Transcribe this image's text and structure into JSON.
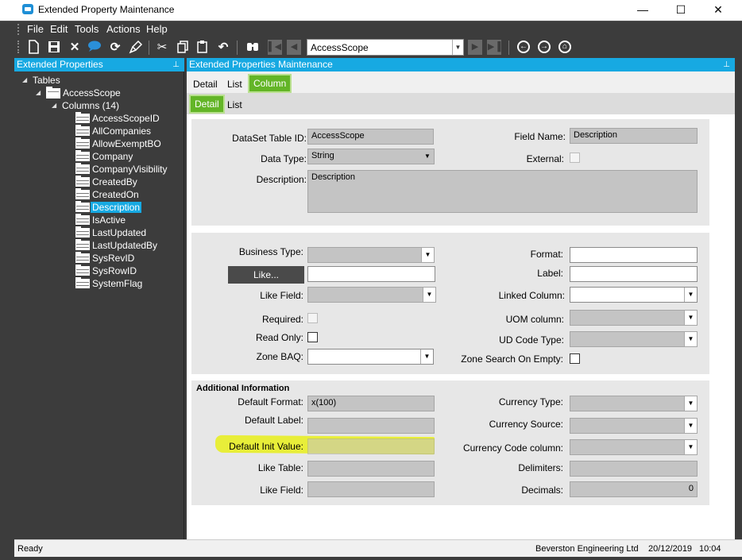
{
  "window": {
    "title": "Extended Property Maintenance",
    "minimize": "—",
    "maximize": "☐",
    "close": "✕"
  },
  "menu": [
    "File",
    "Edit",
    "Tools",
    "Actions",
    "Help"
  ],
  "toolbar": {
    "combo_value": "AccessScope"
  },
  "left_panel": {
    "header": "Extended Properties",
    "pin": "⊥",
    "tree": {
      "root": "Tables",
      "table": "AccessScope",
      "columns_label": "Columns (14)",
      "columns": [
        "AccessScopeID",
        "AllCompanies",
        "AllowExemptBO",
        "Company",
        "CompanyVisibility",
        "CreatedBy",
        "CreatedOn",
        "Description",
        "IsActive",
        "LastUpdated",
        "LastUpdatedBy",
        "SysRevID",
        "SysRowID",
        "SystemFlag"
      ],
      "selected": "Description"
    }
  },
  "right_panel": {
    "header": "Extended Properties Maintenance",
    "pin": "⊥",
    "tabs_outer": [
      "Detail",
      "List",
      "Column"
    ],
    "tabs_inner": [
      "Detail",
      "List"
    ]
  },
  "form": {
    "dataset_table_id_label": "DataSet Table ID:",
    "dataset_table_id": "AccessScope",
    "field_name_label": "Field Name:",
    "field_name": "Description",
    "data_type_label": "Data Type:",
    "data_type": "String",
    "external_label": "External:",
    "description_label": "Description:",
    "description": "Description",
    "business_type_label": "Business Type:",
    "format_label": "Format:",
    "like_button": "Like...",
    "label_label": "Label:",
    "like_field_label": "Like Field:",
    "linked_column_label": "Linked Column:",
    "required_label": "Required:",
    "uom_column_label": "UOM column:",
    "read_only_label": "Read Only:",
    "ud_code_type_label": "UD Code Type:",
    "zone_baq_label": "Zone BAQ:",
    "zone_search_label": "Zone Search On Empty:",
    "additional_info_title": "Additional Information",
    "default_format_label": "Default Format:",
    "default_format": "x(100)",
    "currency_type_label": "Currency Type:",
    "default_label_label": "Default Label:",
    "currency_source_label": "Currency Source:",
    "default_init_value_label": "Default Init Value:",
    "currency_code_column_label": "Currency Code column:",
    "like_table_label": "Like Table:",
    "delimiters_label": "Delimiters:",
    "like_field2_label": "Like Field:",
    "decimals_label": "Decimals:",
    "decimals": "0"
  },
  "status": {
    "left": "Ready",
    "company": "Beverston Engineering Ltd",
    "date": "20/12/2019",
    "time": "10:04"
  },
  "colors": {
    "accent": "#17a9e2",
    "tab_active": "#63b527",
    "highlight": "#e8ee1a"
  }
}
